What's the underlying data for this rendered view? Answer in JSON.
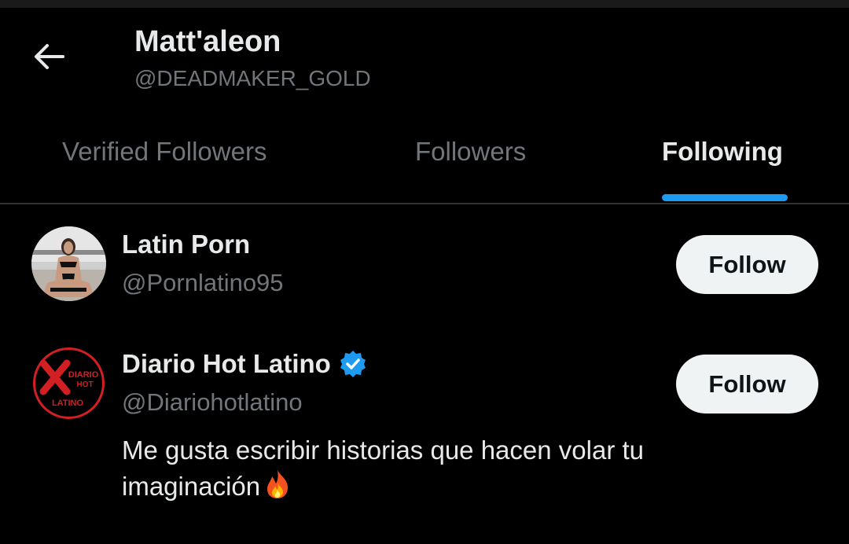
{
  "header": {
    "back_icon": "arrow-left-icon",
    "name": "Matt'aleon",
    "handle": "@DEADMAKER_GOLD"
  },
  "tabs": [
    {
      "label": "Verified Followers",
      "active": false
    },
    {
      "label": "Followers",
      "active": false
    },
    {
      "label": "Following",
      "active": true
    }
  ],
  "accent_color": "#1d9bf0",
  "users": [
    {
      "name": "Latin Porn",
      "handle": "@Pornlatino95",
      "verified": false,
      "bio": "",
      "follow_label": "Follow"
    },
    {
      "name": "Diario Hot Latino",
      "handle": "@Diariohotlatino",
      "verified": true,
      "bio": "Me gusta escribir historias que hacen volar tu imaginación",
      "bio_emoji": "fire-icon",
      "follow_label": "Follow",
      "logo_text": [
        "DIARIO",
        "HOT",
        "LATINO"
      ]
    }
  ]
}
